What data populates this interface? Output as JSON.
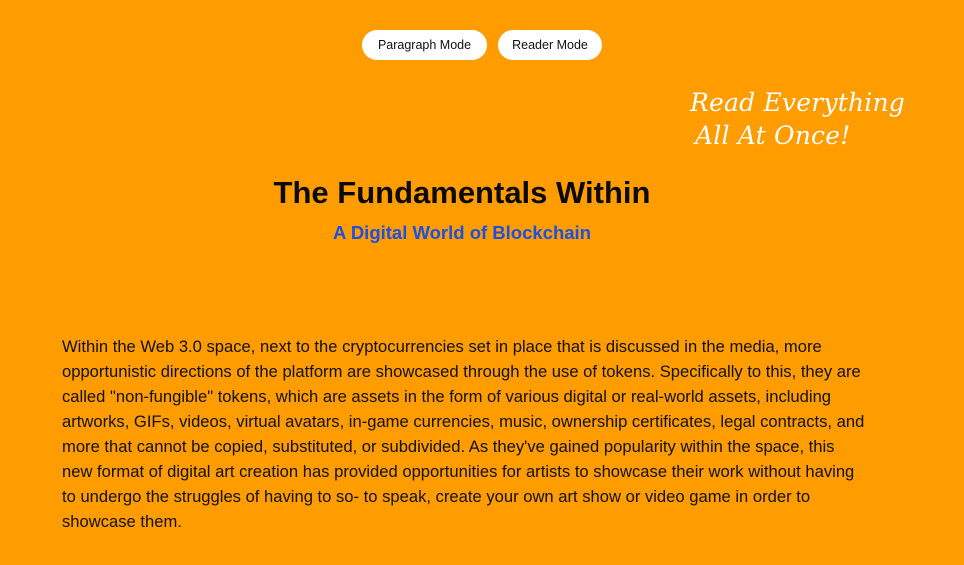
{
  "modes": {
    "paragraph_label": "Paragraph Mode",
    "reader_label": "Reader Mode"
  },
  "tagline": {
    "line1": "Read Everything",
    "line2": "All At Once!"
  },
  "article": {
    "title": "The Fundamentals Within",
    "subtitle": "A Digital World of Blockchain",
    "body": "Within the Web 3.0 space, next to the cryptocurrencies set in place that is discussed in the media, more opportunistic directions of the platform are showcased through the use of tokens. Specifically to this, they are called \"non-fungible\" tokens, which are assets in the form of various digital or real-world assets, including artworks, GIFs, videos, virtual avatars, in-game currencies, music, ownership certificates, legal contracts, and more that cannot be copied, substituted, or subdivided. As they've gained popularity within the space, this new format of digital art creation has provided opportunities for artists to showcase their work without having to undergo the struggles of having to so- to speak, create your own art show or video game in order to showcase them."
  },
  "colors": {
    "background": "#FF9C00",
    "subtitle": "#1E4FE0",
    "button_bg": "#FFFFFF",
    "tagline": "#FFFFFF"
  }
}
